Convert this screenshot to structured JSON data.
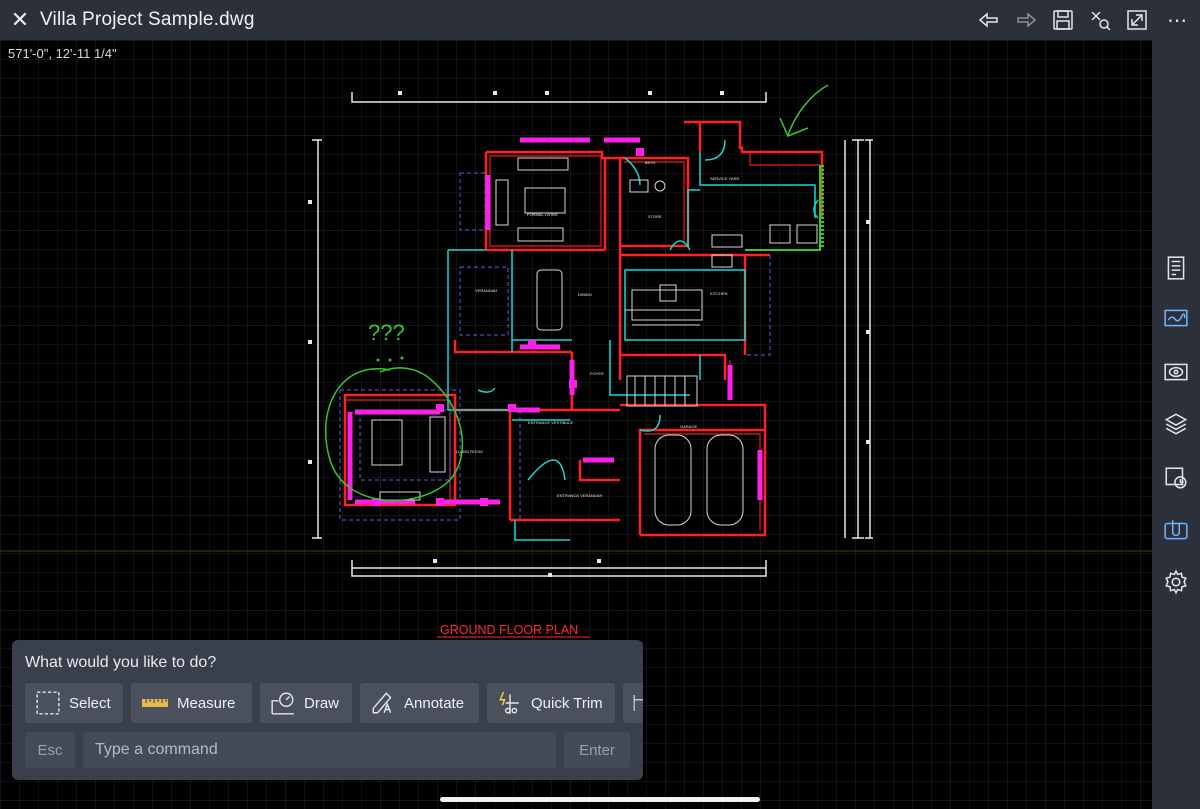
{
  "window": {
    "title": "Villa Project Sample.dwg",
    "close_icon": "close-icon",
    "actions": [
      "undo-icon",
      "redo-icon",
      "save-icon",
      "trim-tool-icon",
      "fullscreen-icon",
      "more-icon"
    ],
    "more_label": "⋯"
  },
  "canvas": {
    "coordinates": "571'-0\",  12'-11 1/4\"",
    "drawing_label": "GROUND FLOOR PLAN",
    "annotation_text": "???",
    "room_labels": [
      "FORMAL LIVING",
      "BATH",
      "STORE",
      "SERVICE YARD",
      "KITCHEN",
      "VERANDAH",
      "DINING",
      "FOYER",
      "LIVING ROOM",
      "ENTRANCE VESTIBULE",
      "ENTRANCE VERANDAH",
      "GARAGE"
    ],
    "colors": {
      "walls": "#ff2020",
      "cyan": "#19d6d6",
      "magenta": "#ff20e8",
      "markup": "#35c82e",
      "grid": "#2a2d33"
    }
  },
  "sidebar": {
    "items": [
      "properties-icon",
      "markup-icon",
      "view-icon",
      "layers-icon",
      "blocks-icon",
      "attachments-icon",
      "settings-icon"
    ]
  },
  "command": {
    "prompt": "What would you like to do?",
    "tools": [
      {
        "label": "Select",
        "icon": "select-icon"
      },
      {
        "label": "Measure",
        "icon": "ruler-icon"
      },
      {
        "label": "Draw",
        "icon": "draw-icon"
      },
      {
        "label": "Annotate",
        "icon": "annotate-icon"
      },
      {
        "label": "Quick Trim",
        "icon": "quick-trim-icon"
      }
    ],
    "esc_label": "Esc",
    "input_placeholder": "Type a command",
    "enter_label": "Enter"
  }
}
